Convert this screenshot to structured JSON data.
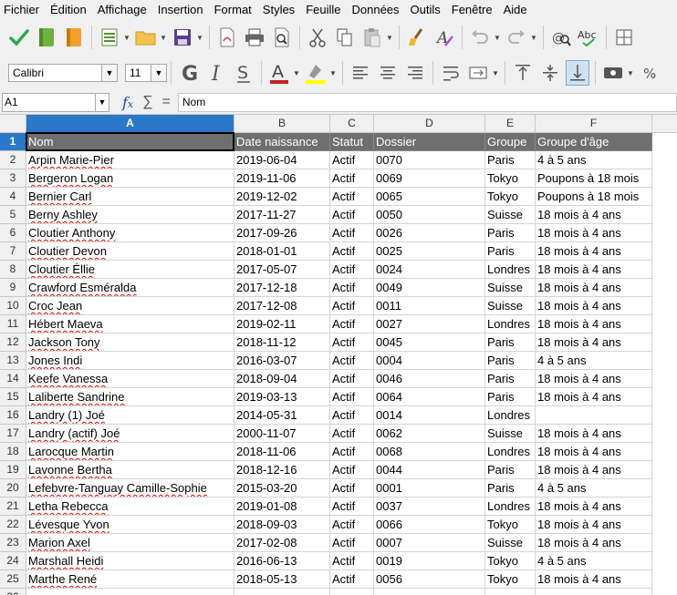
{
  "menu": [
    "Fichier",
    "Édition",
    "Affichage",
    "Insertion",
    "Format",
    "Styles",
    "Feuille",
    "Données",
    "Outils",
    "Fenêtre",
    "Aide"
  ],
  "font_name": "Calibri",
  "font_size": "11",
  "name_box": "A1",
  "formula_content": "Nom",
  "column_letters": [
    "A",
    "B",
    "C",
    "D",
    "E",
    "F"
  ],
  "selected_cell": "A1",
  "table": {
    "headers": [
      "Nom",
      "Date naissance",
      "Statut",
      "Dossier",
      "Groupe",
      "Groupe d'âge"
    ],
    "rows": [
      [
        "Arpin Marie-Pier",
        "2019-06-04",
        "Actif",
        "0070",
        "Paris",
        "4 à 5 ans"
      ],
      [
        "Bergeron Logan",
        "2019-11-06",
        "Actif",
        "0069",
        "Tokyo",
        "Poupons à 18 mois"
      ],
      [
        "Bernier Carl",
        "2019-12-02",
        "Actif",
        "0065",
        "Tokyo",
        "Poupons à 18 mois"
      ],
      [
        "Berny Ashley",
        "2017-11-27",
        "Actif",
        "0050",
        "Suisse",
        "18 mois à 4 ans"
      ],
      [
        "Cloutier Anthony",
        "2017-09-26",
        "Actif",
        "0026",
        "Paris",
        "18 mois à 4 ans"
      ],
      [
        "Cloutier Devon",
        "2018-01-01",
        "Actif",
        "0025",
        "Paris",
        "18 mois à 4 ans"
      ],
      [
        "Cloutier Éllie",
        "2017-05-07",
        "Actif",
        "0024",
        "Londres",
        "18 mois à 4 ans"
      ],
      [
        "Crawford Esméralda",
        "2017-12-18",
        "Actif",
        "0049",
        "Suisse",
        "18 mois à 4 ans"
      ],
      [
        "Croc Jean",
        "2017-12-08",
        "Actif",
        "0011",
        "Suisse",
        "18 mois à 4 ans"
      ],
      [
        "Hébert Maeva",
        "2019-02-11",
        "Actif",
        "0027",
        "Londres",
        "18 mois à 4 ans"
      ],
      [
        "Jackson Tony",
        "2018-11-12",
        "Actif",
        "0045",
        "Paris",
        "18 mois à 4 ans"
      ],
      [
        "Jones Indi",
        "2016-03-07",
        "Actif",
        "0004",
        "Paris",
        "4 à 5 ans"
      ],
      [
        "Keefe Vanessa",
        "2018-09-04",
        "Actif",
        "0046",
        "Paris",
        "18 mois à 4 ans"
      ],
      [
        "Laliberte Sandrine",
        "2019-03-13",
        "Actif",
        "0064",
        "Paris",
        "18 mois à 4 ans"
      ],
      [
        "Landry (1) Joé",
        "2014-05-31",
        "Actif",
        "0014",
        "Londres",
        ""
      ],
      [
        "Landry (actif) Joé",
        "2000-11-07",
        "Actif",
        "0062",
        "Suisse",
        "18 mois à 4 ans"
      ],
      [
        "Larocque Martin",
        "2018-11-06",
        "Actif",
        "0068",
        "Londres",
        "18 mois à 4 ans"
      ],
      [
        "Lavonne Bertha",
        "2018-12-16",
        "Actif",
        "0044",
        "Paris",
        "18 mois à 4 ans"
      ],
      [
        "Lefebvre-Tanguay Camille-Sophie",
        "2015-03-20",
        "Actif",
        "0001",
        "Paris",
        "4 à 5 ans"
      ],
      [
        "Letha Rebecca",
        "2019-01-08",
        "Actif",
        "0037",
        "Londres",
        "18 mois à 4 ans"
      ],
      [
        "Lévesque Yvon",
        "2018-09-03",
        "Actif",
        "0066",
        "Tokyo",
        "18 mois à 4 ans"
      ],
      [
        "Marion Axel",
        "2017-02-08",
        "Actif",
        "0007",
        "Suisse",
        "18 mois à 4 ans"
      ],
      [
        "Marshall Heidi",
        "2016-06-13",
        "Actif",
        "0019",
        "Tokyo",
        "4 à 5 ans"
      ],
      [
        "Marthe René",
        "2018-05-13",
        "Actif",
        "0056",
        "Tokyo",
        "18 mois à 4 ans"
      ]
    ]
  },
  "colors": {
    "header_fill": "#6f6f6f",
    "selection": "#2a78c8",
    "spell_underline": "#e00000"
  }
}
